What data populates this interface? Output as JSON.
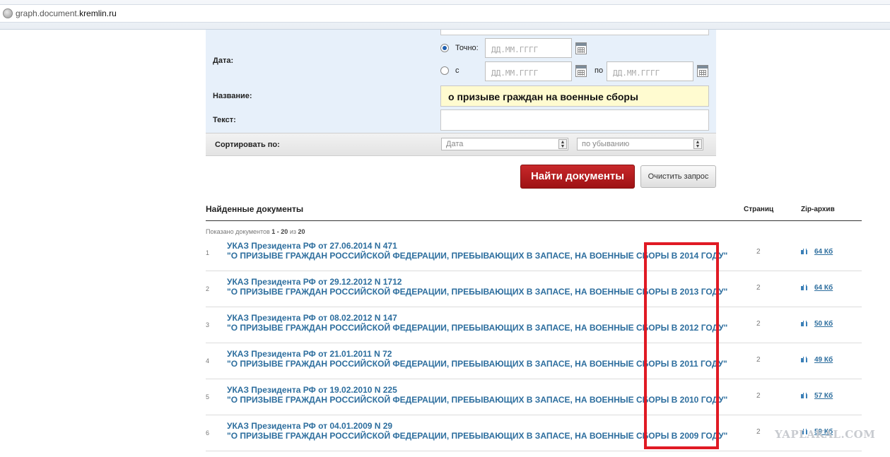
{
  "browser": {
    "url_prefix": "graph.document.",
    "url_domain": "kremlin.ru"
  },
  "form": {
    "date_label": "Дата:",
    "exact_label": "Точно:",
    "from_label": "с",
    "to_label": "по",
    "date_placeholder": "ДД.ММ.ГГГГ",
    "exact_selected": true,
    "title_label": "Название:",
    "title_value": "о призыве граждан на военные сборы",
    "text_label": "Текст:",
    "text_value": "",
    "sort_label": "Сортировать по:",
    "sort_field": "Дата",
    "sort_order": "по убыванию",
    "find_button": "Найти документы",
    "clear_button": "Очистить запрос"
  },
  "results": {
    "heading": "Найденные документы",
    "col_pages": "Страниц",
    "col_zip": "Zip-архив",
    "shown_prefix": "Показано документов ",
    "shown_range": "1 - 20",
    "shown_middle": " из ",
    "shown_total": "20",
    "items": [
      {
        "num": "1",
        "title": "УКАЗ Президента РФ от 27.06.2014 N 471",
        "subtitle": "\"О ПРИЗЫВЕ ГРАЖДАН РОССИЙСКОЙ ФЕДЕРАЦИИ, ПРЕБЫВАЮЩИХ В ЗАПАСЕ, НА ВОЕННЫЕ СБОРЫ В 2014 ГОДУ\"",
        "pages": "2",
        "zip": "64 Кб"
      },
      {
        "num": "2",
        "title": "УКАЗ Президента РФ от 29.12.2012 N 1712",
        "subtitle": "\"О ПРИЗЫВЕ ГРАЖДАН РОССИЙСКОЙ ФЕДЕРАЦИИ, ПРЕБЫВАЮЩИХ В ЗАПАСЕ, НА ВОЕННЫЕ СБОРЫ В 2013 ГОДУ\"",
        "pages": "2",
        "zip": "64 Кб"
      },
      {
        "num": "3",
        "title": "УКАЗ Президента РФ от 08.02.2012 N 147",
        "subtitle": "\"О ПРИЗЫВЕ ГРАЖДАН РОССИЙСКОЙ ФЕДЕРАЦИИ, ПРЕБЫВАЮЩИХ В ЗАПАСЕ, НА ВОЕННЫЕ СБОРЫ В 2012 ГОДУ\"",
        "pages": "2",
        "zip": "50 Кб"
      },
      {
        "num": "4",
        "title": "УКАЗ Президента РФ от 21.01.2011 N 72",
        "subtitle": "\"О ПРИЗЫВЕ ГРАЖДАН РОССИЙСКОЙ ФЕДЕРАЦИИ, ПРЕБЫВАЮЩИХ В ЗАПАСЕ, НА ВОЕННЫЕ СБОРЫ В 2011 ГОДУ\"",
        "pages": "2",
        "zip": "49 Кб"
      },
      {
        "num": "5",
        "title": "УКАЗ Президента РФ от 19.02.2010 N 225",
        "subtitle": "\"О ПРИЗЫВЕ ГРАЖДАН РОССИЙСКОЙ ФЕДЕРАЦИИ, ПРЕБЫВАЮЩИХ В ЗАПАСЕ, НА ВОЕННЫЕ СБОРЫ В 2010 ГОДУ\"",
        "pages": "2",
        "zip": "57 Кб"
      },
      {
        "num": "6",
        "title": "УКАЗ Президента РФ от 04.01.2009 N 29",
        "subtitle": "\"О ПРИЗЫВЕ ГРАЖДАН РОССИЙСКОЙ ФЕДЕРАЦИИ, ПРЕБЫВАЮЩИХ В ЗАПАСЕ, НА ВОЕННЫЕ СБОРЫ В 2009 ГОДУ\"",
        "pages": "2",
        "zip": "59 Кб"
      }
    ]
  },
  "annotation": {
    "highlight_color": "#e01a24"
  },
  "watermark": "YAPLAKAL.COM"
}
